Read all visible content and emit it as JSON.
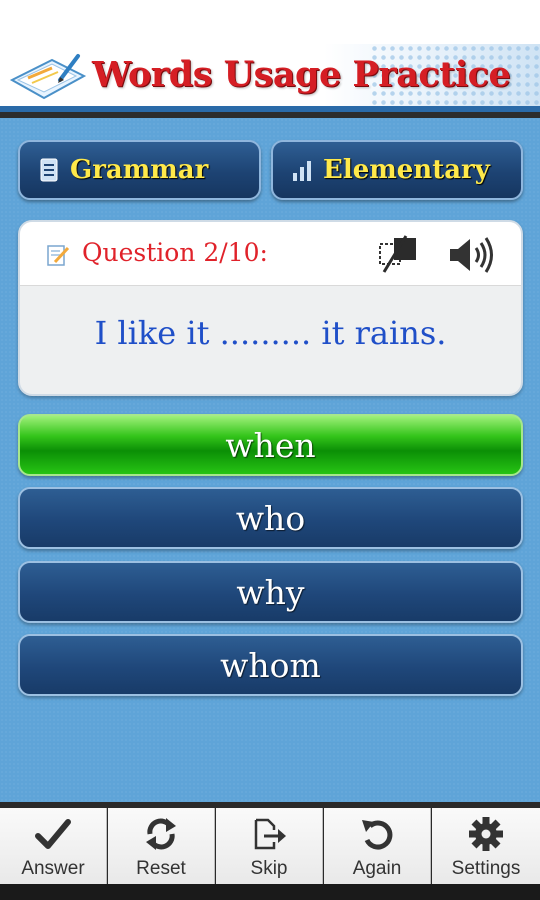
{
  "app": {
    "title": "Words Usage Practice"
  },
  "category": {
    "label": "Grammar",
    "icon": "document-icon"
  },
  "level": {
    "label": "Elementary",
    "icon": "bars-icon"
  },
  "question": {
    "label": "Question 2/10:",
    "text": "I like it ......... it rains."
  },
  "answers": [
    {
      "label": "when",
      "state": "selected-correct"
    },
    {
      "label": "who",
      "state": "default"
    },
    {
      "label": "why",
      "state": "default"
    },
    {
      "label": "whom",
      "state": "default"
    }
  ],
  "toolbar": [
    {
      "label": "Answer",
      "icon": "checkmark-icon"
    },
    {
      "label": "Reset",
      "icon": "reset-icon"
    },
    {
      "label": "Skip",
      "icon": "skip-icon"
    },
    {
      "label": "Again",
      "icon": "again-icon"
    },
    {
      "label": "Settings",
      "icon": "gear-icon"
    }
  ],
  "colors": {
    "title_red": "#d51e24",
    "pill_text": "#ffe94a",
    "question_red": "#e0222a",
    "question_blue": "#1f4fc8",
    "correct_green": "#33c41a",
    "button_blue": "#1f477a",
    "background_blue": "#5fa4d8"
  }
}
